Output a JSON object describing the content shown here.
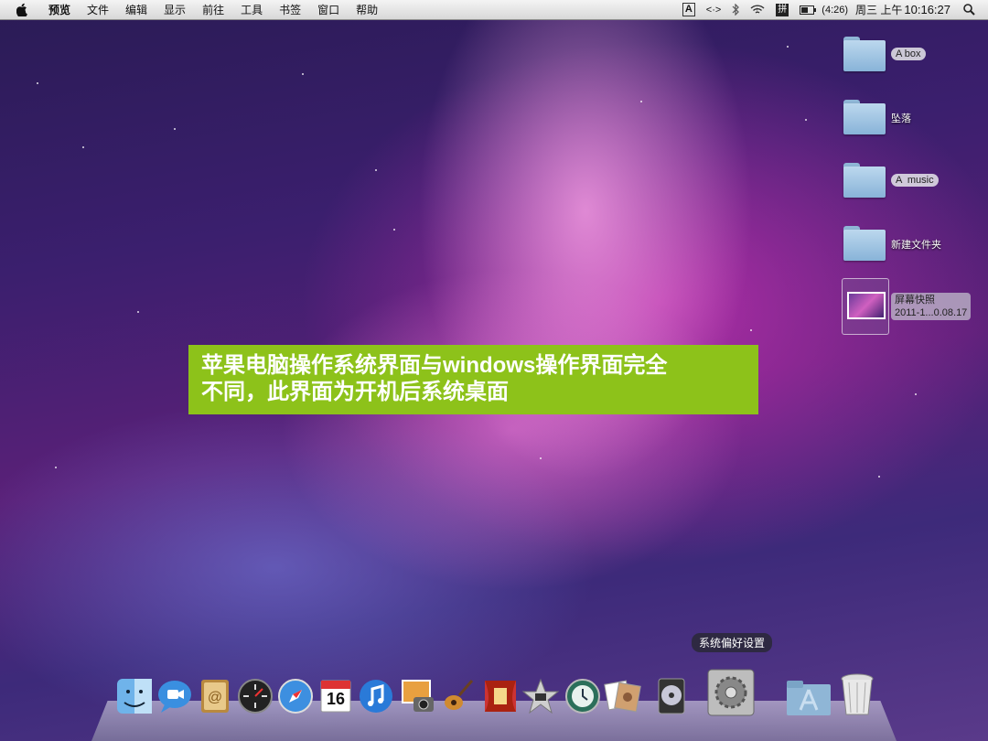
{
  "menubar": {
    "app_name": "预览",
    "items": [
      "文件",
      "编辑",
      "显示",
      "前往",
      "工具",
      "书签",
      "窗口",
      "帮助"
    ],
    "tray": {
      "input_indicator": "A",
      "bracket": "<·>",
      "battery": "(4:26)",
      "ime": "拼",
      "day_period": "周三 上午",
      "time": "10:16:27"
    }
  },
  "desktop_icons": [
    {
      "label": "A box"
    },
    {
      "label": "坠落"
    },
    {
      "label": "A  music"
    },
    {
      "label": "新建文件夹"
    },
    {
      "label_line1": "屏幕快照",
      "label_line2": "2011-1...0.08.17"
    }
  ],
  "caption": {
    "line1": "苹果电脑操作系统界面与windows操作界面完全",
    "line2": "不同，此界面为开机后系统桌面"
  },
  "dock": {
    "tooltip": "系统偏好设置",
    "calendar_day": "16",
    "items": [
      "finder-icon",
      "ichat-icon",
      "address-book-icon",
      "dashboard-icon",
      "safari-icon",
      "ical-icon",
      "itunes-icon",
      "iphoto-icon",
      "garageband-icon",
      "front-row-icon",
      "imovie-icon",
      "time-machine-icon",
      "photo-booth-icon",
      "dvd-player-icon",
      "system-preferences-icon",
      "applications-folder-icon",
      "trash-icon"
    ]
  }
}
